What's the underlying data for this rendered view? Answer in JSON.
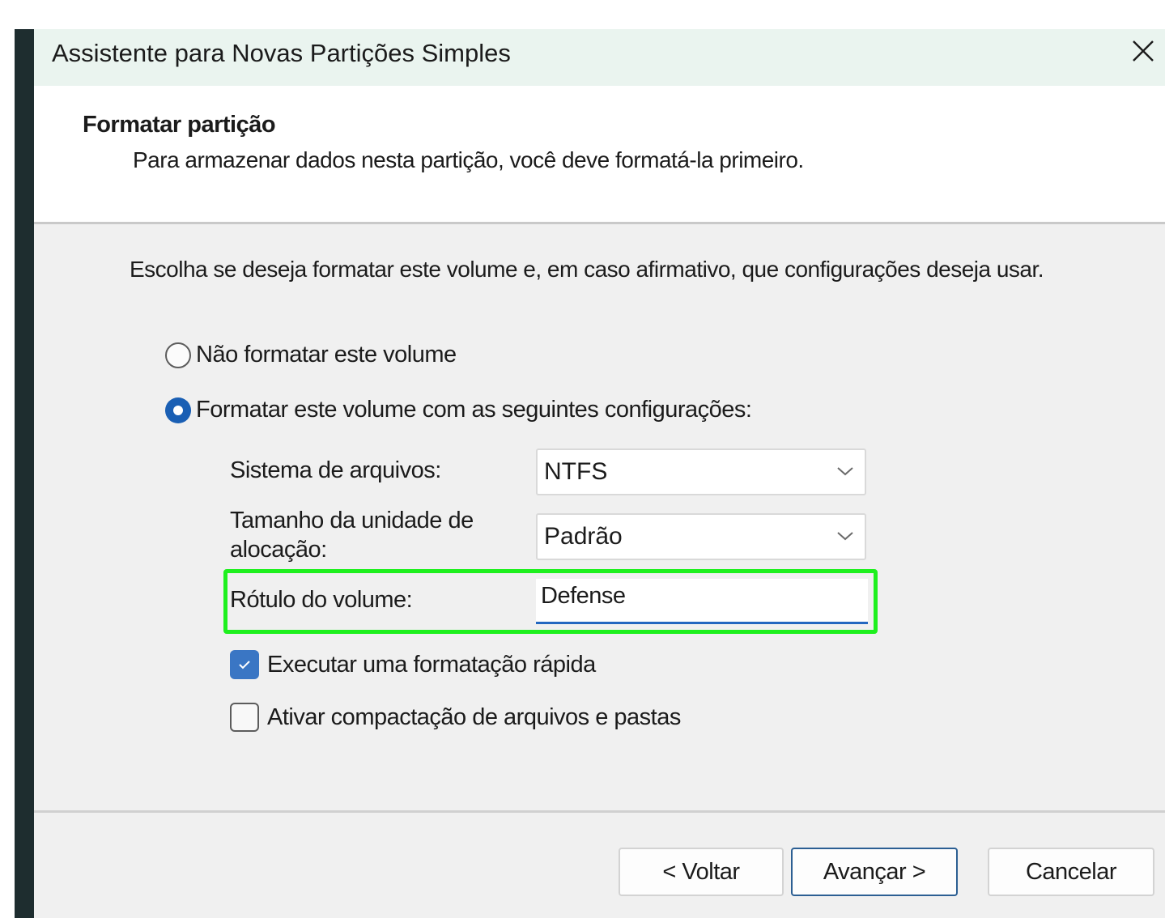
{
  "window": {
    "title": "Assistente para Novas Partições Simples",
    "close_glyph": "×"
  },
  "header": {
    "title": "Formatar partição",
    "subtitle": "Para armazenar dados nesta partição, você deve formatá-la primeiro."
  },
  "body": {
    "intro": "Escolha se deseja formatar este volume e, em caso afirmativo, que configurações deseja usar.",
    "options": {
      "no_format": {
        "label": "Não formatar este volume",
        "selected": false
      },
      "format": {
        "label": "Formatar este volume com as seguintes configurações:",
        "selected": true
      }
    },
    "fields": {
      "file_system": {
        "label": "Sistema de arquivos:",
        "value": "NTFS"
      },
      "allocation": {
        "label": "Tamanho da unidade de alocação:",
        "value": "Padrão"
      },
      "volume_label": {
        "label": "Rótulo do volume:",
        "value": "Defense"
      }
    },
    "checkboxes": {
      "quick_format": {
        "label": "Executar uma formatação rápida",
        "checked": true
      },
      "compression": {
        "label": "Ativar compactação de arquivos e pastas",
        "checked": false
      }
    }
  },
  "footer": {
    "back_label": "< Voltar",
    "next_label": "Avançar >",
    "cancel_label": "Cancelar"
  },
  "colors": {
    "accent": "#1a5fb4",
    "highlight": "#1ef01e",
    "titlebar_bg": "#eaf4ef",
    "body_bg": "#f0f0f0"
  },
  "icons": {
    "close": "close-icon",
    "dropdown": "chevron-down-icon",
    "check": "checkmark-icon"
  }
}
